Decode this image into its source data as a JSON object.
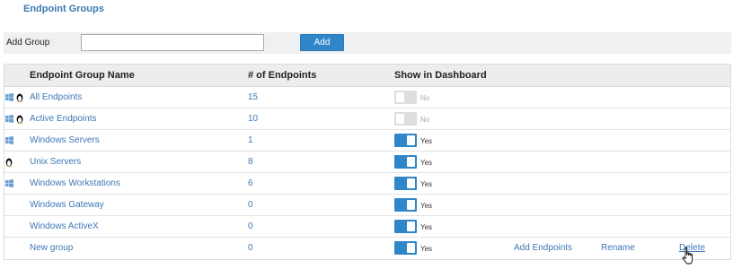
{
  "page": {
    "title": "Endpoint Groups"
  },
  "add_group": {
    "label": "Add Group",
    "input_value": "",
    "placeholder": "",
    "button_label": "Add"
  },
  "table": {
    "headers": {
      "name": "Endpoint Group Name",
      "count": "# of Endpoints",
      "dashboard": "Show in Dashboard"
    },
    "rows": [
      {
        "name": "All Endpoints",
        "count": "15",
        "show": "No",
        "icons": [
          "windows-icon",
          "linux-icon"
        ]
      },
      {
        "name": "Active Endpoints",
        "count": "10",
        "show": "No",
        "icons": [
          "windows-icon",
          "linux-icon"
        ]
      },
      {
        "name": "Windows Servers",
        "count": "1",
        "show": "Yes",
        "icons": [
          "windows-icon"
        ]
      },
      {
        "name": "Unix Servers",
        "count": "8",
        "show": "Yes",
        "icons": [
          "linux-icon"
        ]
      },
      {
        "name": "Windows Workstations",
        "count": "6",
        "show": "Yes",
        "icons": [
          "windows-icon"
        ]
      },
      {
        "name": "Windows Gateway",
        "count": "0",
        "show": "Yes",
        "icons": []
      },
      {
        "name": "Windows ActiveX",
        "count": "0",
        "show": "Yes",
        "icons": []
      },
      {
        "name": "New group",
        "count": "0",
        "show": "Yes",
        "icons": [],
        "actions": {
          "add_endpoints": "Add Endpoints",
          "rename": "Rename",
          "delete": "Delete"
        }
      }
    ]
  },
  "colors": {
    "accent": "#2f86c8",
    "link": "#3c78b4",
    "toggle_off": "#dedede"
  }
}
